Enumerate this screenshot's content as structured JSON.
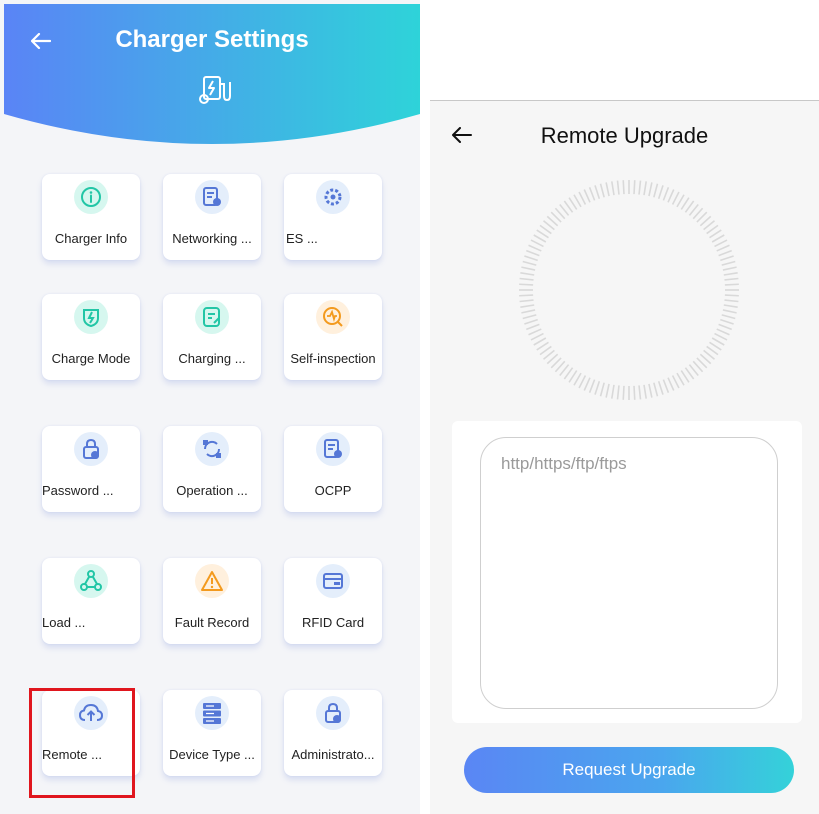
{
  "left_screen": {
    "header": {
      "title": "Charger Settings",
      "back_icon": "arrow-left-icon",
      "decor_icon": "charger-icon",
      "gradient": [
        "#5a84f6",
        "#2ed3d9"
      ]
    },
    "tiles": [
      {
        "label": "Charger Info",
        "icon": "info-icon",
        "icon_bg": "#d6f7ef",
        "icon_color": "#22c6a6"
      },
      {
        "label": "Networking ...",
        "icon": "document-gear-icon",
        "icon_bg": "#e4eefb",
        "icon_color": "#5577d6"
      },
      {
        "label": "ES ...",
        "icon": "gear-cluster-icon",
        "icon_bg": "#e4eefb",
        "icon_color": "#5577d6"
      },
      {
        "label": "Charge Mode",
        "icon": "plug-shield-icon",
        "icon_bg": "#d6f7ef",
        "icon_color": "#22c6a6"
      },
      {
        "label": "Charging ...",
        "icon": "note-edit-icon",
        "icon_bg": "#d6f7ef",
        "icon_color": "#22c6a6"
      },
      {
        "label": "Self-inspection",
        "icon": "pulse-search-icon",
        "icon_bg": "#fff0dd",
        "icon_color": "#f39a1e"
      },
      {
        "label": "Password ...",
        "icon": "lock-check-icon",
        "icon_bg": "#e4eefb",
        "icon_color": "#5577d6"
      },
      {
        "label": "Operation ...",
        "icon": "sync-icon",
        "icon_bg": "#e4eefb",
        "icon_color": "#5577d6"
      },
      {
        "label": "OCPP",
        "icon": "document-gear-icon",
        "icon_bg": "#e4eefb",
        "icon_color": "#5577d6"
      },
      {
        "label": "Load ...",
        "icon": "network-nodes-icon",
        "icon_bg": "#d6f7ef",
        "icon_color": "#22c6a6"
      },
      {
        "label": "Fault Record",
        "icon": "warning-icon",
        "icon_bg": "#fff0dd",
        "icon_color": "#f39a1e"
      },
      {
        "label": "RFID Card",
        "icon": "card-icon",
        "icon_bg": "#e4eefb",
        "icon_color": "#5577d6"
      },
      {
        "label": "Remote ...",
        "icon": "cloud-upload-icon",
        "icon_bg": "#e4eefb",
        "icon_color": "#5577d6"
      },
      {
        "label": "Device Type ...",
        "icon": "server-stack-icon",
        "icon_bg": "#e4eefb",
        "icon_color": "#5577d6"
      },
      {
        "label": "Administrato...",
        "icon": "lock-check-icon",
        "icon_bg": "#e4eefb",
        "icon_color": "#5577d6"
      }
    ],
    "highlight_color": "#e0161e"
  },
  "right_screen": {
    "title": "Remote Upgrade",
    "back_icon": "arrow-left-icon",
    "url_placeholder": "http/https/ftp/ftps",
    "url_value": "",
    "request_button": "Request Upgrade",
    "dial_icon": "progress-dial-icon"
  }
}
